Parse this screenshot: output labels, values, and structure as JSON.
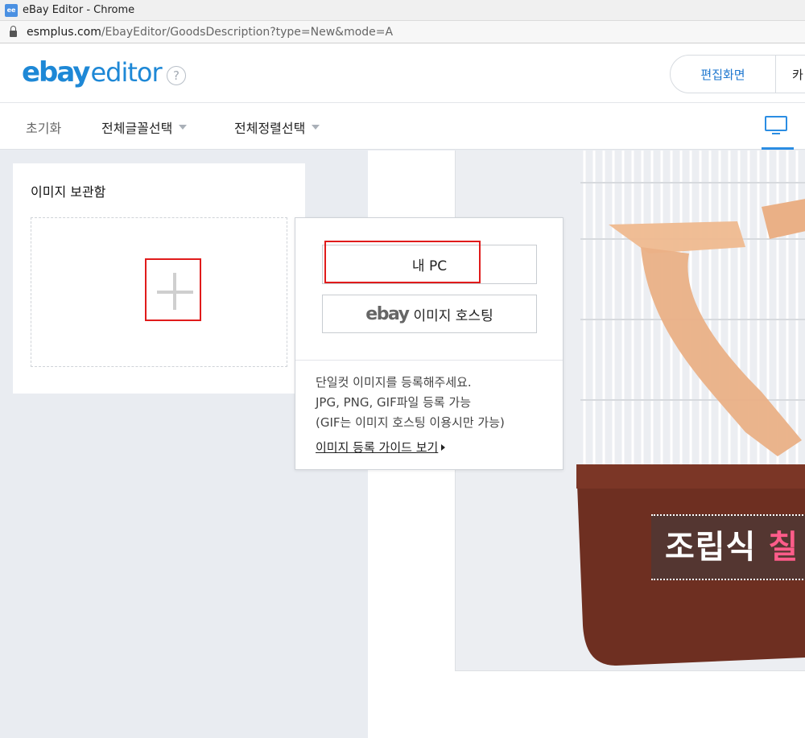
{
  "window": {
    "title": "eBay Editor - Chrome",
    "app_icon": "ebay-editor-icon"
  },
  "address_bar": {
    "host": "esmplus.com",
    "path": "/EbayEditor/GoodsDescription?type=New&mode=A"
  },
  "header": {
    "logo_bold": "ebay",
    "logo_light": "editor",
    "help_label": "?",
    "edit_view_label": "편집화면",
    "category_label": "카"
  },
  "toolbar": {
    "reset_label": "초기화",
    "font_select_label": "전체글꼴선택",
    "align_select_label": "전체정렬선택"
  },
  "image_box": {
    "title": "이미지 보관함"
  },
  "popup": {
    "my_pc_label": "내 PC",
    "ebay_logo": "ebay",
    "hosting_label": "이미지 호스팅",
    "note_line1": "단일컷 이미지를 등록해주세요.",
    "note_line2": "JPG, PNG, GIF파일 등록 가능",
    "note_line3": "(GIF는 이미지 호스팅 이용시만 가능)",
    "guide_link": "이미지 등록 가이드 보기"
  },
  "preview": {
    "banner_white": "조립식 ",
    "banner_pink": "칠"
  },
  "colors": {
    "accent": "#1e88d6",
    "highlight": "#e01b1b"
  }
}
